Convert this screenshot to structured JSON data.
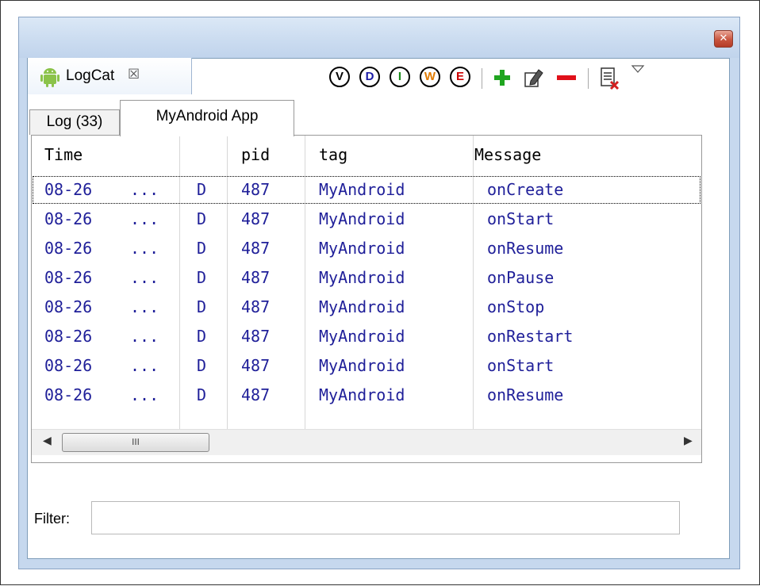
{
  "view": {
    "title": "LogCat",
    "close_glyph": "☒"
  },
  "toolbar": {
    "levels": [
      {
        "letter": "V",
        "color": "#000000"
      },
      {
        "letter": "D",
        "color": "#1a1aa6"
      },
      {
        "letter": "I",
        "color": "#1a8a1a"
      },
      {
        "letter": "W",
        "color": "#e07a00"
      },
      {
        "letter": "E",
        "color": "#cc0000"
      }
    ],
    "icons": [
      "add-filter-icon",
      "edit-filter-icon",
      "delete-filter-icon",
      "clear-log-icon",
      "view-menu-icon"
    ]
  },
  "tabs": {
    "log_label": "Log (33)",
    "app_label": "MyAndroid App"
  },
  "table": {
    "headers": {
      "time": "Time",
      "level": "",
      "pid": "pid",
      "tag": "tag",
      "message": "Message"
    },
    "rows": [
      {
        "time": "08-26",
        "more": "...",
        "level": "D",
        "pid": "487",
        "tag": "MyAndroid",
        "message": "onCreate"
      },
      {
        "time": "08-26",
        "more": "...",
        "level": "D",
        "pid": "487",
        "tag": "MyAndroid",
        "message": "onStart"
      },
      {
        "time": "08-26",
        "more": "...",
        "level": "D",
        "pid": "487",
        "tag": "MyAndroid",
        "message": "onResume"
      },
      {
        "time": "08-26",
        "more": "...",
        "level": "D",
        "pid": "487",
        "tag": "MyAndroid",
        "message": "onPause"
      },
      {
        "time": "08-26",
        "more": "...",
        "level": "D",
        "pid": "487",
        "tag": "MyAndroid",
        "message": "onStop"
      },
      {
        "time": "08-26",
        "more": "...",
        "level": "D",
        "pid": "487",
        "tag": "MyAndroid",
        "message": "onRestart"
      },
      {
        "time": "08-26",
        "more": "...",
        "level": "D",
        "pid": "487",
        "tag": "MyAndroid",
        "message": "onStart"
      },
      {
        "time": "08-26",
        "more": "...",
        "level": "D",
        "pid": "487",
        "tag": "MyAndroid",
        "message": "onResume"
      }
    ],
    "scroll_grip": "III"
  },
  "filter": {
    "label": "Filter:",
    "value": ""
  },
  "colors": {
    "row_text": "#1f1f99"
  }
}
